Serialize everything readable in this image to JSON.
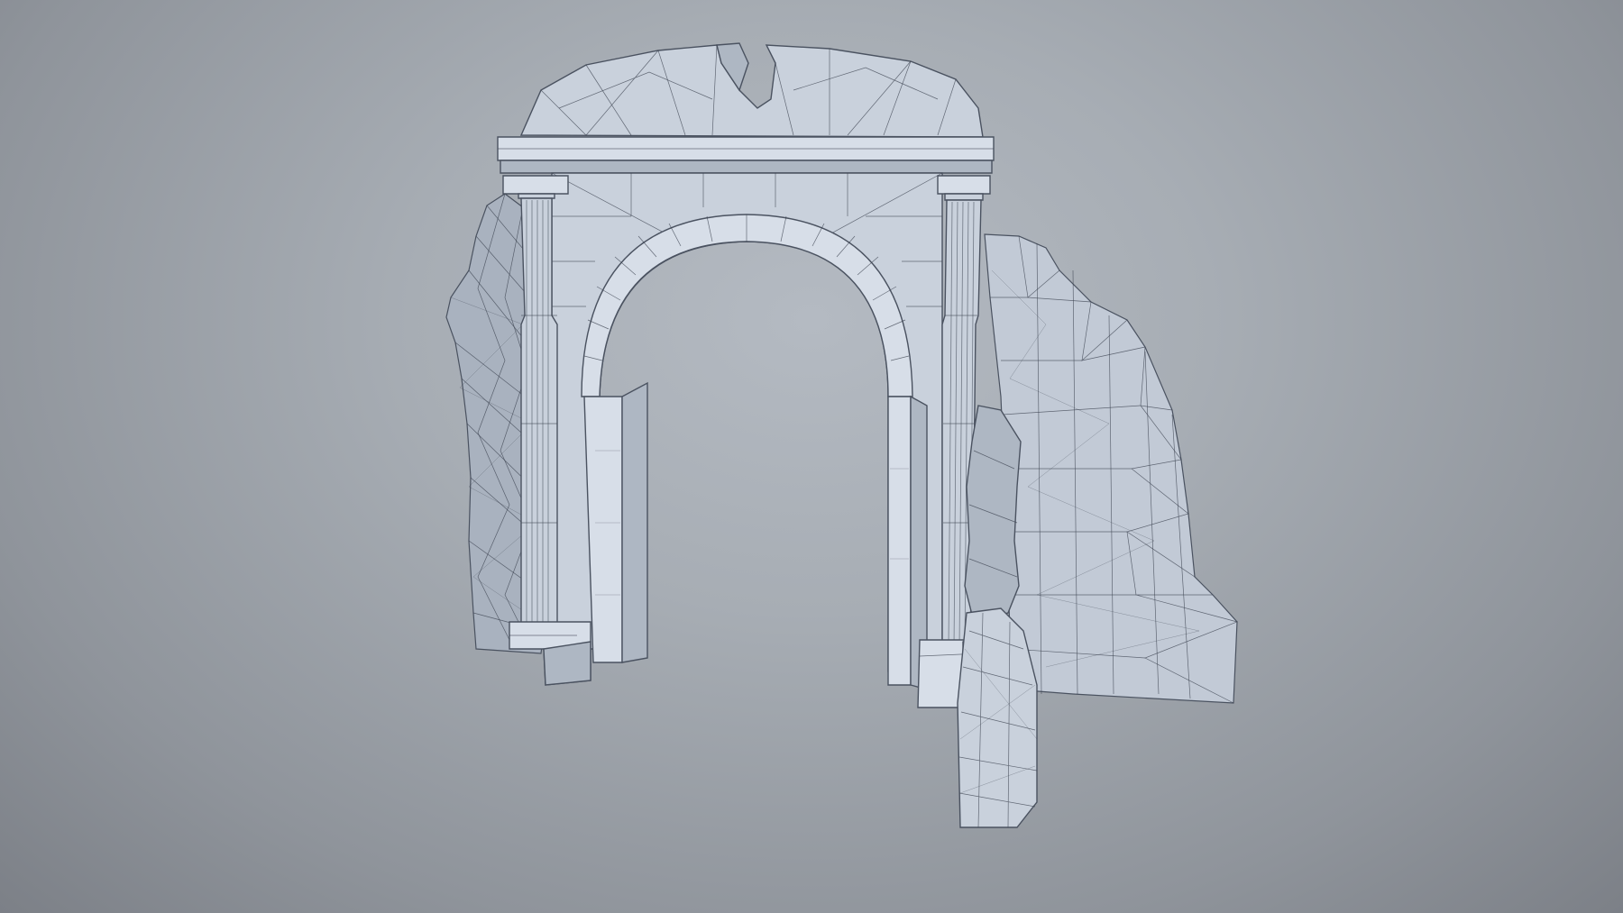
{
  "scene": {
    "subject": "stone-archway-3d-model",
    "colors": {
      "background_center": "#b4bac2",
      "background_edge": "#7c8087",
      "stone": "#c9d1dc",
      "wireframe": "#3d4452"
    }
  }
}
